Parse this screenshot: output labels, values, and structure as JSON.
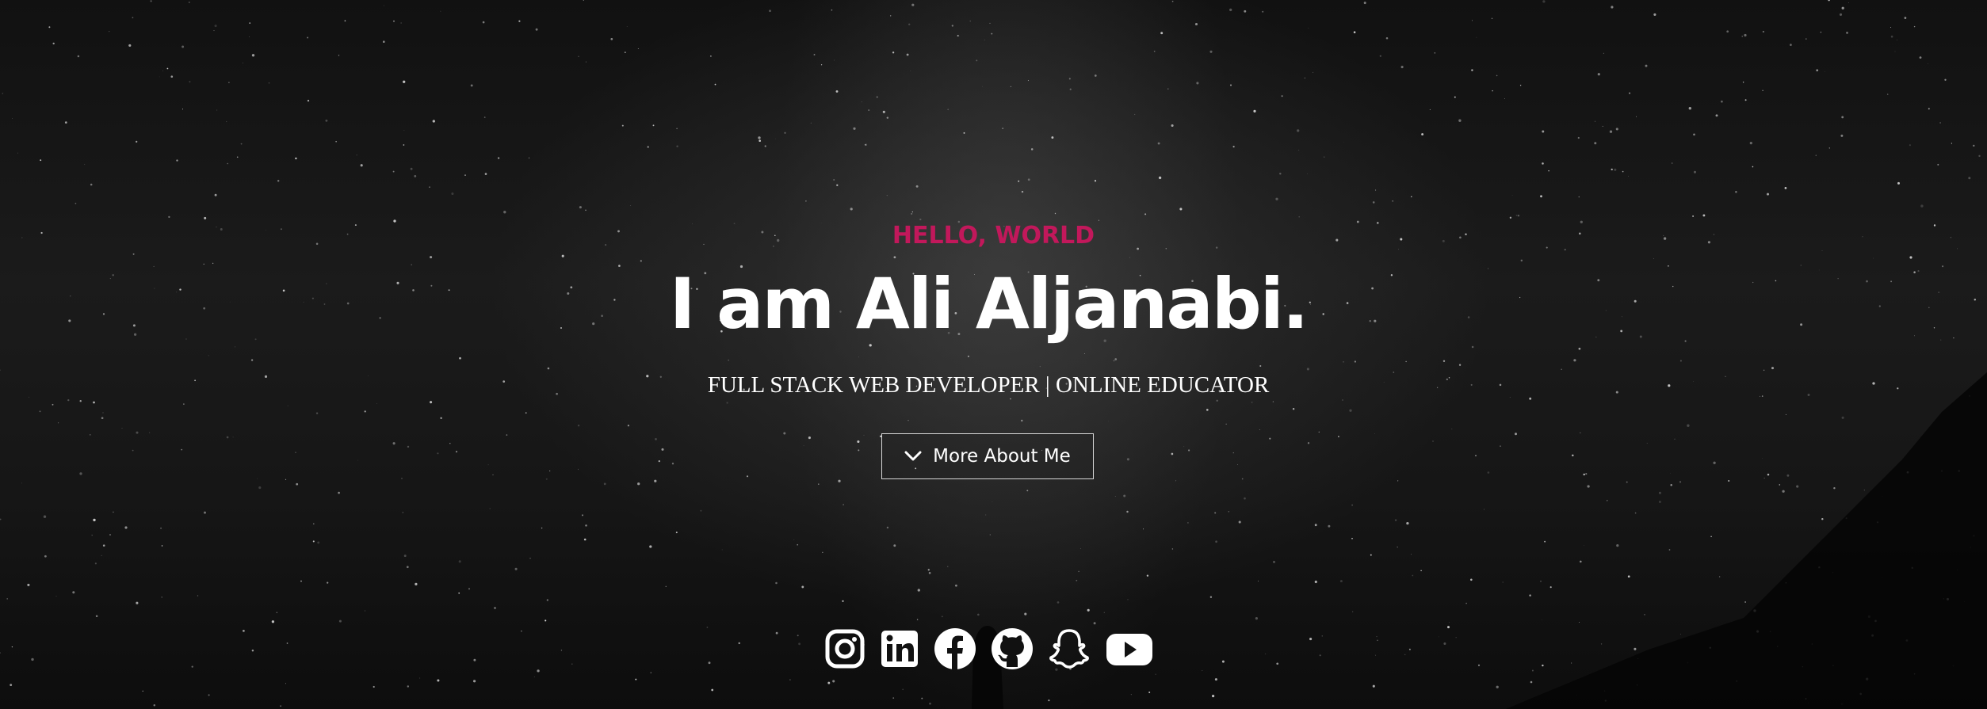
{
  "hero": {
    "eyebrow": "HELLO, WORLD",
    "headline": "I am Ali Aljanabi.",
    "subtitle": "FULL STACK WEB DEVELOPER | ONLINE EDUCATOR",
    "cta_label": "More About Me",
    "cta_icon": "chevron-down-icon"
  },
  "socials": [
    {
      "name": "instagram-icon"
    },
    {
      "name": "linkedin-icon"
    },
    {
      "name": "facebook-icon"
    },
    {
      "name": "github-icon"
    },
    {
      "name": "snapchat-icon"
    },
    {
      "name": "youtube-icon"
    }
  ],
  "colors": {
    "accent": "#c2185b",
    "text": "#ffffff",
    "background": "#111111"
  }
}
